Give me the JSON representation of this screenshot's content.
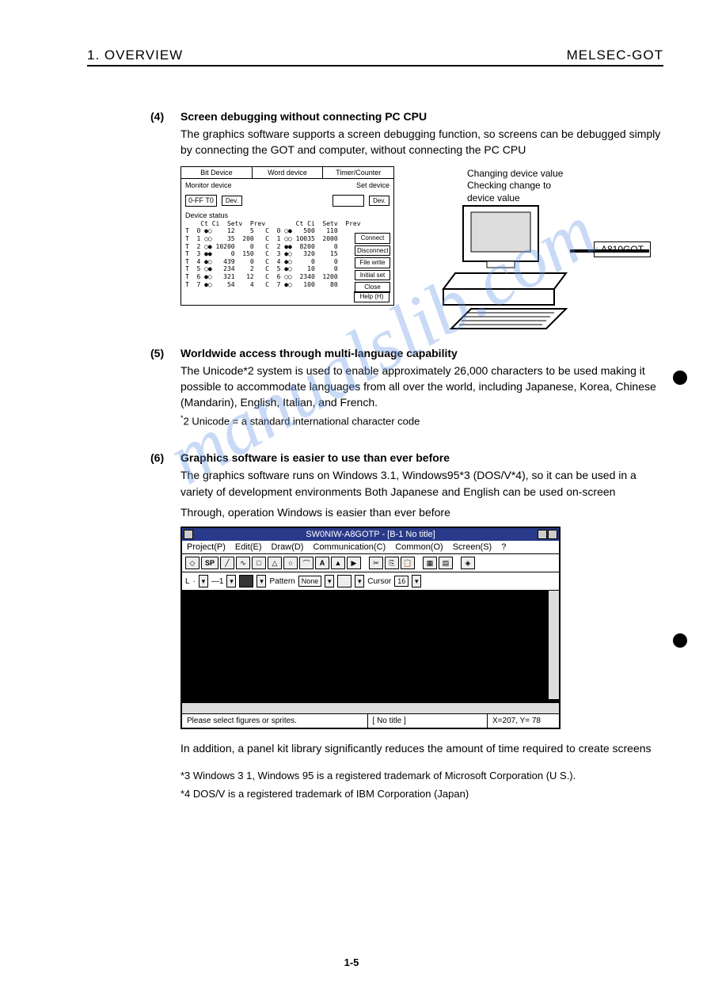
{
  "header": {
    "left": "1.  OVERVIEW",
    "right": "MELSEC-GOT"
  },
  "sec4": {
    "num": "(4)",
    "title": "Screen debugging without connecting PC CPU",
    "body": "The graphics software supports a screen debugging function, so screens can be debugged simply by connecting the GOT and computer, without connecting the PC CPU"
  },
  "debugbox": {
    "tabs": [
      "Bit Device",
      "Word device",
      "Timer/Counter"
    ],
    "monitor_label": "Monitor device",
    "monitor_value": "0-FF T0",
    "dev_btn": "Dev.",
    "set_label": "Set device",
    "status_label": "Device status",
    "hdr": "    Ct Ci  Setv  Prev        Ct Ci  Setv  Prev",
    "rows": [
      "T  0 ●○    12    5   C  0 ○●   500   110",
      "T  1 ○○    35  200   C  1 ○○ 10035  2000",
      "T  2 ○● 10200    0   C  2 ●●  8200     0",
      "T  3 ●●     0  150   C  3 ●○   320    15",
      "T  4 ●○   439    0   C  4 ●○     0     0",
      "T  5 ○●   234    2   C  5 ●○    10     0",
      "T  6 ●○   321   12   C  6 ○○  2340  1200",
      "T  7 ●○    54    4   C  7 ●○   100    80"
    ],
    "side_buttons": [
      "Connect",
      "Disconnect",
      "File write",
      "Initial set",
      "Close"
    ],
    "help_btn": "Help (H)"
  },
  "annot1": "Changing device value\nChecking change to\ndevice value",
  "got_label": "A810GOT",
  "sec5": {
    "num": "(5)",
    "title": "Worldwide access through multi-language capability",
    "body": "The Unicode*2 system is used to enable approximately 26,000 characters to be used making it possible to accommodate languages from all over the world, including Japanese, Korea, Chinese (Mandarin), English, Italian, and French.",
    "note": "2 Unicode = a standard international character code"
  },
  "sec6": {
    "num": "(6)",
    "title": "Graphics software is easier to use than ever before",
    "body1": "The graphics software runs on Windows 3.1, Windows95*3 (DOS/V*4), so it can be used in a variety of development environments  Both Japanese and English can be used on-screen",
    "body2": "Through, operation Windows is easier than ever before"
  },
  "app": {
    "title": "SW0NIW-A8GOTP - [B-1 No title]",
    "menus": [
      "Project(P)",
      "Edit(E)",
      "Draw(D)",
      "Communication(C)",
      "Common(O)",
      "Screen(S)",
      "?"
    ],
    "prop_pattern": "Pattern",
    "prop_none": "None",
    "prop_cursor": "Cursor",
    "prop_cursor_val": "16",
    "prop_l": "L",
    "prop_neg1": "—1",
    "status_msg": "Please select figures or sprites.",
    "status_doc": "[ No title ]",
    "status_xy": "X=207, Y= 78"
  },
  "after_app": "In addition, a panel kit library significantly reduces the amount of time required to create screens",
  "tm1": "*3 Windows 3 1, Windows 95 is a registered trademark of Microsoft Corporation (U S.).",
  "tm2": "*4 DOS/V is a registered trademark of IBM Corporation (Japan)",
  "pagenum": "1-5",
  "watermark": "manualslib.com"
}
